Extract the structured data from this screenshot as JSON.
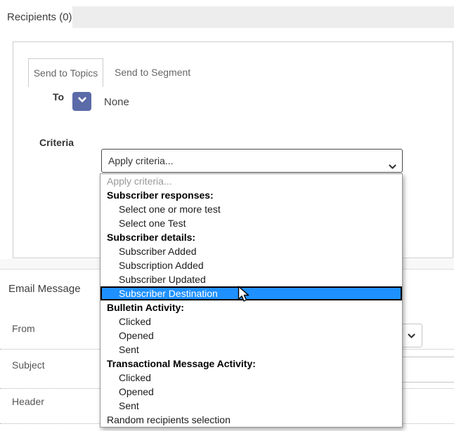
{
  "window": {
    "tab": "Recipients (0)"
  },
  "recipients_panel": {
    "tabs": [
      {
        "label": "Send to Topics",
        "active": true
      },
      {
        "label": "Send to Segment",
        "active": false
      }
    ],
    "to": {
      "label": "To",
      "value": "None"
    },
    "criteria": {
      "label": "Criteria",
      "select_value": "Apply criteria..."
    }
  },
  "criteria_dropdown": {
    "items": [
      {
        "label": "Apply criteria...",
        "type": "placeholder"
      },
      {
        "label": "Subscriber responses:",
        "type": "group"
      },
      {
        "label": "Select one or more test",
        "type": "option"
      },
      {
        "label": "Select one Test",
        "type": "option"
      },
      {
        "label": "Subscriber details:",
        "type": "group"
      },
      {
        "label": "Subscriber Added",
        "type": "option"
      },
      {
        "label": "Subscription Added",
        "type": "option"
      },
      {
        "label": "Subscriber Updated",
        "type": "option"
      },
      {
        "label": "Subscriber Destination",
        "type": "option",
        "selected": true
      },
      {
        "label": "Bulletin Activity:",
        "type": "group"
      },
      {
        "label": "Clicked",
        "type": "option"
      },
      {
        "label": "Opened",
        "type": "option"
      },
      {
        "label": "Sent",
        "type": "option"
      },
      {
        "label": "Transactional Message Activity:",
        "type": "group"
      },
      {
        "label": "Clicked",
        "type": "option"
      },
      {
        "label": "Opened",
        "type": "option"
      },
      {
        "label": "Sent",
        "type": "option"
      },
      {
        "label": "Random recipients selection",
        "type": "plain"
      }
    ]
  },
  "email_message": {
    "title": "Email Message",
    "fields": [
      {
        "label": "From",
        "control": "select"
      },
      {
        "label": "Subject",
        "control": "input"
      },
      {
        "label": "Header",
        "control": "none"
      }
    ]
  },
  "colors": {
    "to_button": "#5b6ba8",
    "option_highlight": "#1e90ff",
    "tab_strip": "#ededed"
  }
}
